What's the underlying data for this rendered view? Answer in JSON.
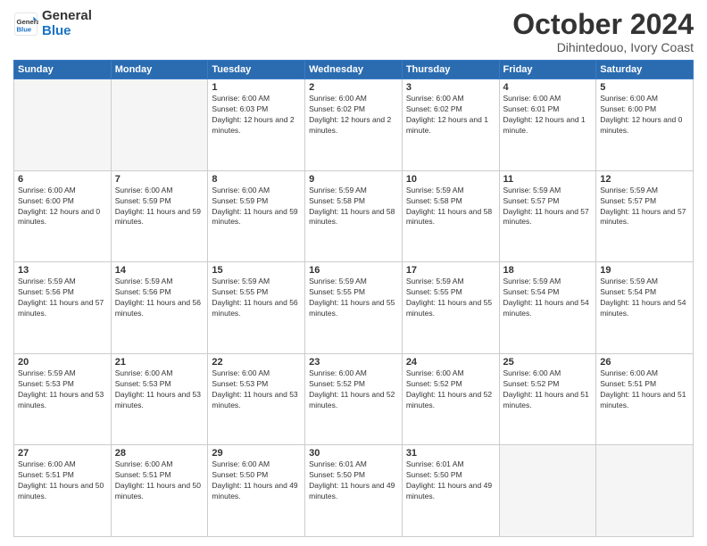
{
  "header": {
    "logo_line1": "General",
    "logo_line2": "Blue",
    "month": "October 2024",
    "location": "Dihintedouo, Ivory Coast"
  },
  "weekdays": [
    "Sunday",
    "Monday",
    "Tuesday",
    "Wednesday",
    "Thursday",
    "Friday",
    "Saturday"
  ],
  "weeks": [
    [
      {
        "day": "",
        "empty": true
      },
      {
        "day": "",
        "empty": true
      },
      {
        "day": "1",
        "sunrise": "6:00 AM",
        "sunset": "6:03 PM",
        "daylight": "12 hours and 2 minutes."
      },
      {
        "day": "2",
        "sunrise": "6:00 AM",
        "sunset": "6:02 PM",
        "daylight": "12 hours and 2 minutes."
      },
      {
        "day": "3",
        "sunrise": "6:00 AM",
        "sunset": "6:02 PM",
        "daylight": "12 hours and 1 minute."
      },
      {
        "day": "4",
        "sunrise": "6:00 AM",
        "sunset": "6:01 PM",
        "daylight": "12 hours and 1 minute."
      },
      {
        "day": "5",
        "sunrise": "6:00 AM",
        "sunset": "6:00 PM",
        "daylight": "12 hours and 0 minutes."
      }
    ],
    [
      {
        "day": "6",
        "sunrise": "6:00 AM",
        "sunset": "6:00 PM",
        "daylight": "12 hours and 0 minutes."
      },
      {
        "day": "7",
        "sunrise": "6:00 AM",
        "sunset": "5:59 PM",
        "daylight": "11 hours and 59 minutes."
      },
      {
        "day": "8",
        "sunrise": "6:00 AM",
        "sunset": "5:59 PM",
        "daylight": "11 hours and 59 minutes."
      },
      {
        "day": "9",
        "sunrise": "5:59 AM",
        "sunset": "5:58 PM",
        "daylight": "11 hours and 58 minutes."
      },
      {
        "day": "10",
        "sunrise": "5:59 AM",
        "sunset": "5:58 PM",
        "daylight": "11 hours and 58 minutes."
      },
      {
        "day": "11",
        "sunrise": "5:59 AM",
        "sunset": "5:57 PM",
        "daylight": "11 hours and 57 minutes."
      },
      {
        "day": "12",
        "sunrise": "5:59 AM",
        "sunset": "5:57 PM",
        "daylight": "11 hours and 57 minutes."
      }
    ],
    [
      {
        "day": "13",
        "sunrise": "5:59 AM",
        "sunset": "5:56 PM",
        "daylight": "11 hours and 57 minutes."
      },
      {
        "day": "14",
        "sunrise": "5:59 AM",
        "sunset": "5:56 PM",
        "daylight": "11 hours and 56 minutes."
      },
      {
        "day": "15",
        "sunrise": "5:59 AM",
        "sunset": "5:55 PM",
        "daylight": "11 hours and 56 minutes."
      },
      {
        "day": "16",
        "sunrise": "5:59 AM",
        "sunset": "5:55 PM",
        "daylight": "11 hours and 55 minutes."
      },
      {
        "day": "17",
        "sunrise": "5:59 AM",
        "sunset": "5:55 PM",
        "daylight": "11 hours and 55 minutes."
      },
      {
        "day": "18",
        "sunrise": "5:59 AM",
        "sunset": "5:54 PM",
        "daylight": "11 hours and 54 minutes."
      },
      {
        "day": "19",
        "sunrise": "5:59 AM",
        "sunset": "5:54 PM",
        "daylight": "11 hours and 54 minutes."
      }
    ],
    [
      {
        "day": "20",
        "sunrise": "5:59 AM",
        "sunset": "5:53 PM",
        "daylight": "11 hours and 53 minutes."
      },
      {
        "day": "21",
        "sunrise": "6:00 AM",
        "sunset": "5:53 PM",
        "daylight": "11 hours and 53 minutes."
      },
      {
        "day": "22",
        "sunrise": "6:00 AM",
        "sunset": "5:53 PM",
        "daylight": "11 hours and 53 minutes."
      },
      {
        "day": "23",
        "sunrise": "6:00 AM",
        "sunset": "5:52 PM",
        "daylight": "11 hours and 52 minutes."
      },
      {
        "day": "24",
        "sunrise": "6:00 AM",
        "sunset": "5:52 PM",
        "daylight": "11 hours and 52 minutes."
      },
      {
        "day": "25",
        "sunrise": "6:00 AM",
        "sunset": "5:52 PM",
        "daylight": "11 hours and 51 minutes."
      },
      {
        "day": "26",
        "sunrise": "6:00 AM",
        "sunset": "5:51 PM",
        "daylight": "11 hours and 51 minutes."
      }
    ],
    [
      {
        "day": "27",
        "sunrise": "6:00 AM",
        "sunset": "5:51 PM",
        "daylight": "11 hours and 50 minutes."
      },
      {
        "day": "28",
        "sunrise": "6:00 AM",
        "sunset": "5:51 PM",
        "daylight": "11 hours and 50 minutes."
      },
      {
        "day": "29",
        "sunrise": "6:00 AM",
        "sunset": "5:50 PM",
        "daylight": "11 hours and 49 minutes."
      },
      {
        "day": "30",
        "sunrise": "6:01 AM",
        "sunset": "5:50 PM",
        "daylight": "11 hours and 49 minutes."
      },
      {
        "day": "31",
        "sunrise": "6:01 AM",
        "sunset": "5:50 PM",
        "daylight": "11 hours and 49 minutes."
      },
      {
        "day": "",
        "empty": true
      },
      {
        "day": "",
        "empty": true
      }
    ]
  ]
}
